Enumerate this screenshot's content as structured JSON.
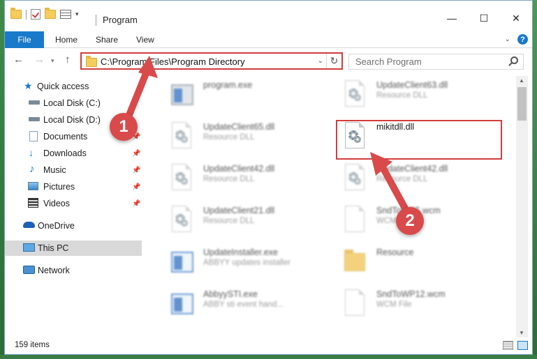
{
  "window": {
    "title": "Program",
    "controls": {
      "minimize": "—",
      "maximize": "☐",
      "close": "✕"
    }
  },
  "ribbon": {
    "tabs": [
      "File",
      "Home",
      "Share",
      "View"
    ],
    "expand_icon": "chevron-down-icon",
    "help": "?"
  },
  "address": {
    "path": "C:\\Program Files\\Program Directory",
    "refresh_icon": "refresh-icon"
  },
  "search": {
    "placeholder": "Search Program"
  },
  "sidebar": {
    "items": [
      {
        "label": "Quick access",
        "icon": "star-icon"
      },
      {
        "label": "Local Disk (C:)",
        "icon": "drive-icon"
      },
      {
        "label": "Local Disk (D:)",
        "icon": "drive-icon"
      },
      {
        "label": "Documents",
        "icon": "documents-icon",
        "pinned": true
      },
      {
        "label": "Downloads",
        "icon": "download-icon",
        "pinned": true
      },
      {
        "label": "Music",
        "icon": "music-icon",
        "pinned": true
      },
      {
        "label": "Pictures",
        "icon": "pictures-icon",
        "pinned": true
      },
      {
        "label": "Videos",
        "icon": "videos-icon",
        "pinned": true
      },
      {
        "label": "OneDrive",
        "icon": "cloud-icon"
      },
      {
        "label": "This PC",
        "icon": "computer-icon",
        "selected": true
      },
      {
        "label": "Network",
        "icon": "network-icon"
      }
    ]
  },
  "files": [
    {
      "name": "program.exe",
      "type": "",
      "icon": "installer-icon"
    },
    {
      "name": "UpdateClient63.dll",
      "type": "Resource DLL",
      "icon": "dll-gear-icon"
    },
    {
      "name": "UpdateClient65.dll",
      "type": "Resource DLL",
      "icon": "dll-gear-icon"
    },
    {
      "name": "mikitdll.dll",
      "type": "",
      "icon": "dll-gear-icon"
    },
    {
      "name": "UpdateClient42.dll",
      "type": "Resource DLL",
      "icon": "dll-gear-icon"
    },
    {
      "name": "UpdateClient42.dll",
      "type": "Resource DLL",
      "icon": "dll-gear-icon"
    },
    {
      "name": "UpdateClient21.dll",
      "type": "Resource DLL",
      "icon": "dll-gear-icon"
    },
    {
      "name": "SndToWP5.wcm",
      "type": "WCM File",
      "icon": "file-icon"
    },
    {
      "name": "UpdateInstaller.exe",
      "type": "ABBYY updates installer",
      "icon": "app-icon"
    },
    {
      "name": "Resource",
      "type": "",
      "icon": "folder-icon"
    },
    {
      "name": "AbbyySTI.exe",
      "type": "ABBY sti event hand...",
      "icon": "app-icon"
    },
    {
      "name": "SndToWP12.wcm",
      "type": "WCM File",
      "icon": "file-icon"
    }
  ],
  "status": {
    "count": "159 items"
  },
  "annotations": {
    "step1": "1",
    "step2": "2"
  },
  "colors": {
    "accent": "#1979ca",
    "highlight": "#d33c3c",
    "selected_bg": "#d9d9d9"
  }
}
